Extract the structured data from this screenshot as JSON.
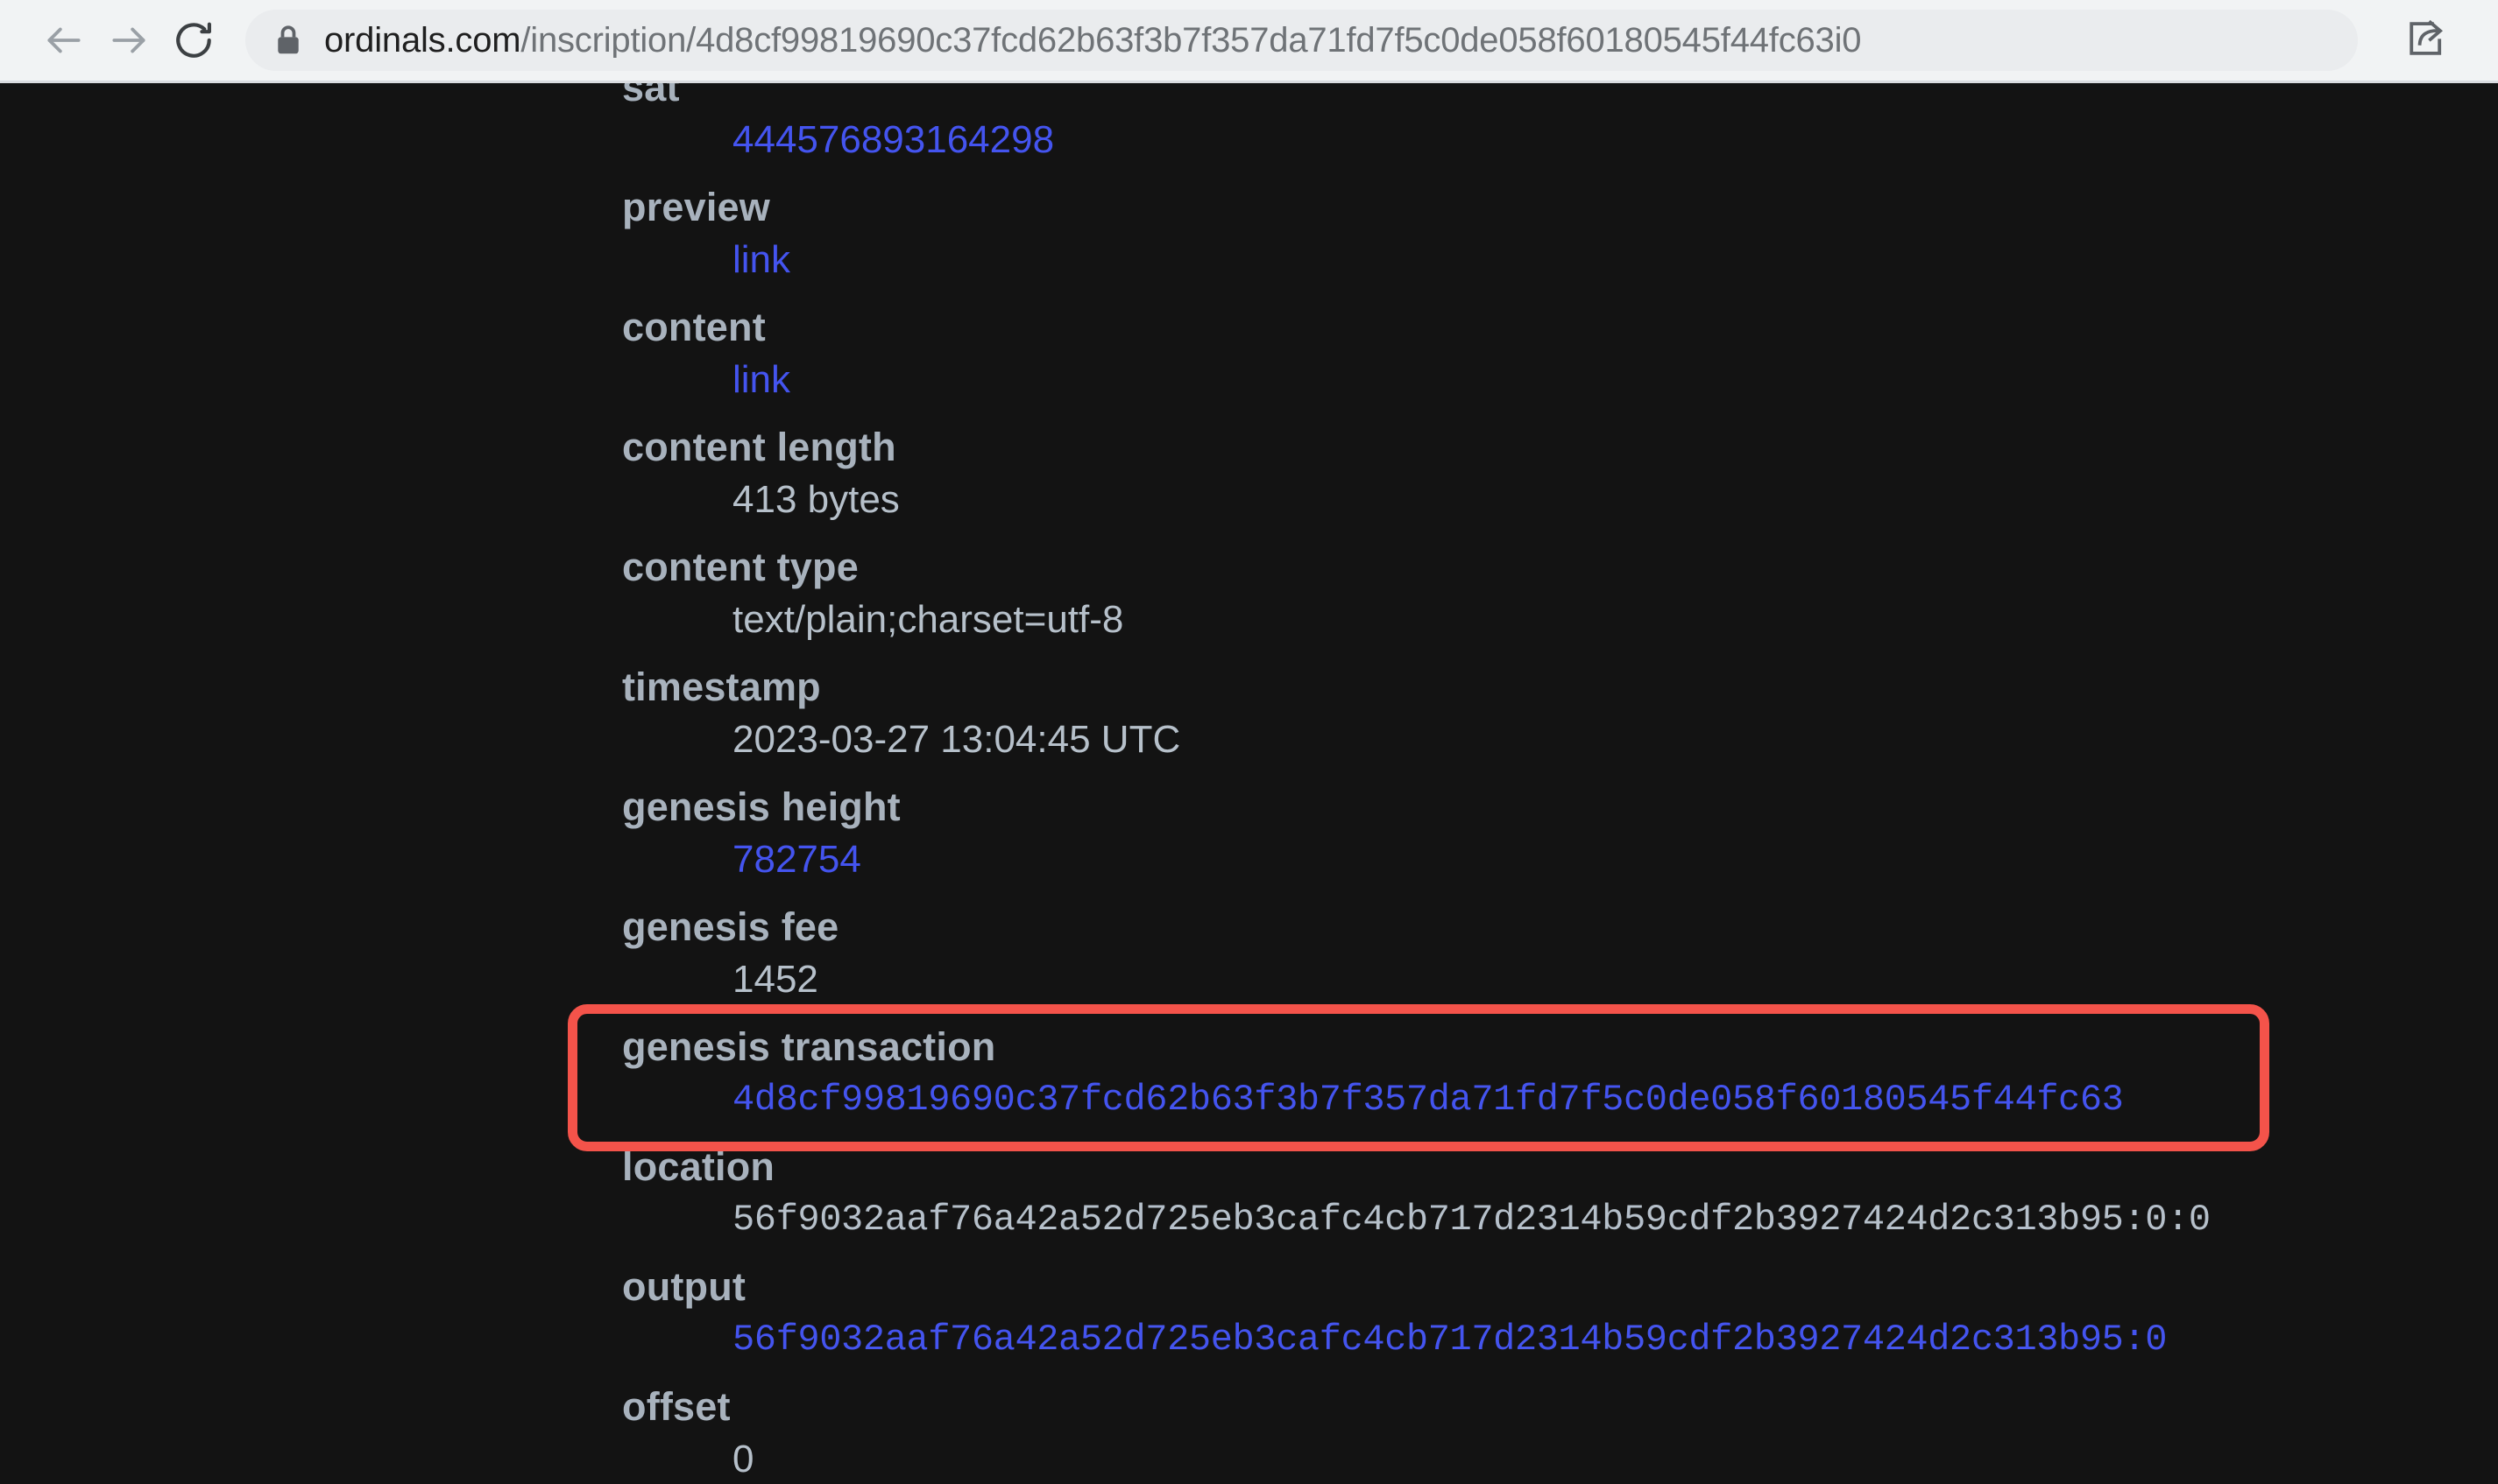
{
  "browser": {
    "back_icon": "arrow-left-icon",
    "forward_icon": "arrow-right-icon",
    "reload_icon": "reload-icon",
    "lock_icon": "lock-icon",
    "share_icon": "share-icon",
    "url_domain": "ordinals.com",
    "url_path": "/inscription/4d8cf99819690c37fcd62b63f3b7f357da71fd7f5c0de058f60180545f44fc63i0",
    "url_full": "ordinals.com/inscription/4d8cf99819690c37fcd62b63f3b7f357da71fd7f5c0de058f60180545f44fc63i0"
  },
  "theme": {
    "page_background": "#131313",
    "chrome_background": "#f1f3f4",
    "omnibox_background": "#eaecee",
    "label_color": "#a8b2bd",
    "value_color": "#b6c0ca",
    "link_color": "#4454ef",
    "highlight_color": "#f4534a"
  },
  "inscription": {
    "rows": [
      {
        "label": "sat",
        "value": "444576893164298",
        "link": true,
        "mono": false
      },
      {
        "label": "preview",
        "value": "link",
        "link": true,
        "mono": false
      },
      {
        "label": "content",
        "value": "link",
        "link": true,
        "mono": false
      },
      {
        "label": "content length",
        "value": "413 bytes",
        "link": false,
        "mono": false
      },
      {
        "label": "content type",
        "value": "text/plain;charset=utf-8",
        "link": false,
        "mono": false
      },
      {
        "label": "timestamp",
        "value": "2023-03-27 13:04:45 UTC",
        "link": false,
        "mono": false
      },
      {
        "label": "genesis height",
        "value": "782754",
        "link": true,
        "mono": false
      },
      {
        "label": "genesis fee",
        "value": "1452",
        "link": false,
        "mono": false
      },
      {
        "label": "genesis transaction",
        "value": "4d8cf99819690c37fcd62b63f3b7f357da71fd7f5c0de058f60180545f44fc63",
        "link": true,
        "mono": true,
        "highlighted": true
      },
      {
        "label": "location",
        "value": "56f9032aaf76a42a52d725eb3cafc4cb717d2314b59cdf2b3927424d2c313b95:0:0",
        "link": false,
        "mono": true
      },
      {
        "label": "output",
        "value": "56f9032aaf76a42a52d725eb3cafc4cb717d2314b59cdf2b3927424d2c313b95:0",
        "link": true,
        "mono": true
      },
      {
        "label": "offset",
        "value": "0",
        "link": false,
        "mono": false
      }
    ]
  }
}
